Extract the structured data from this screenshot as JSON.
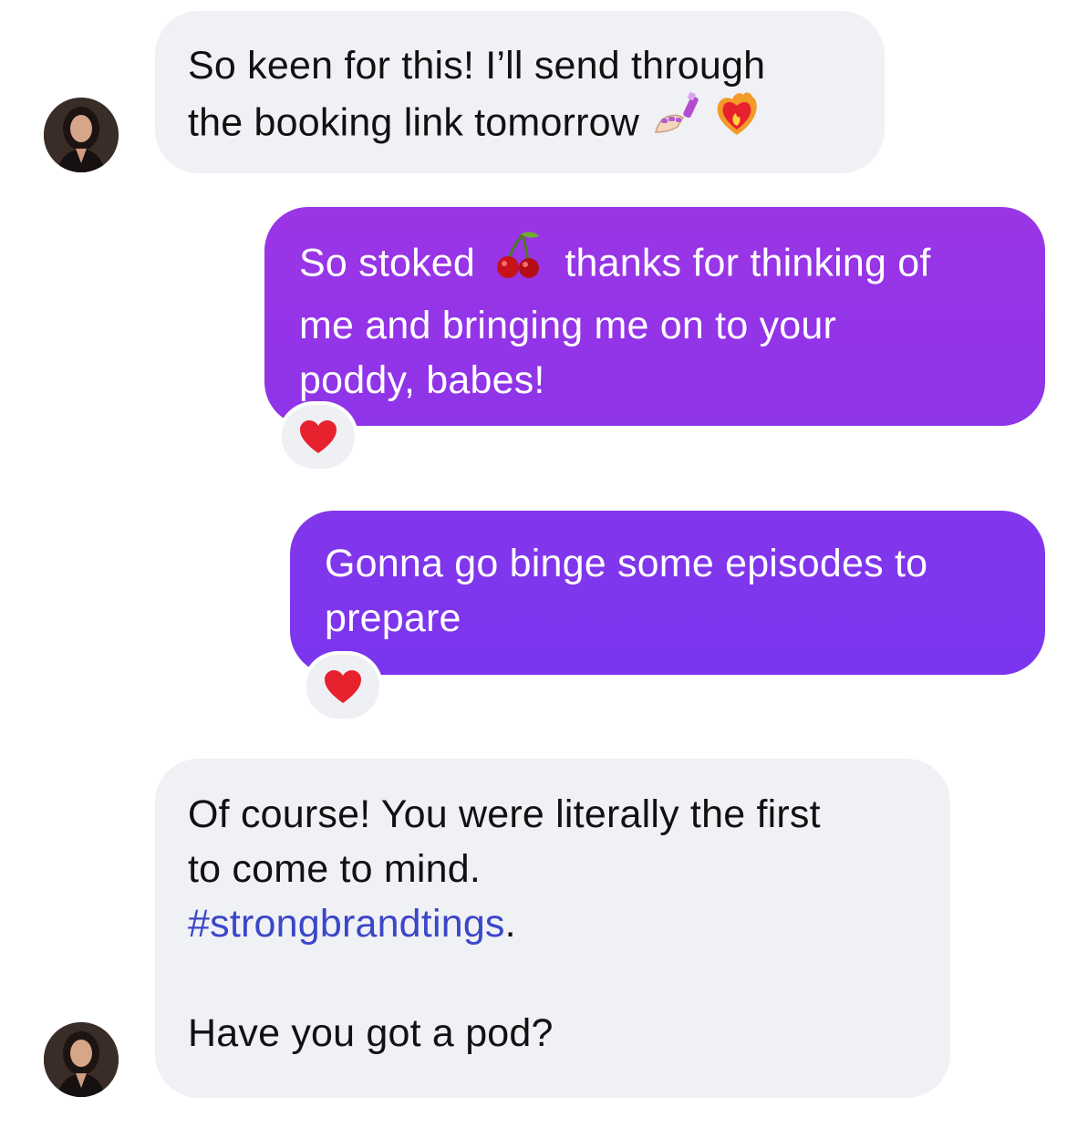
{
  "colors": {
    "incoming_bubble": "#eff1f5",
    "outgoing_gradient_top": "#9b35e6",
    "outgoing_gradient_bottom": "#7b35ee",
    "hashtag": "#3b46c9",
    "reaction_heart": "#e8212e"
  },
  "messages": [
    {
      "sender": "other",
      "lines": [
        "So keen for this! I’ll send through",
        "the booking link tomorrow"
      ],
      "emojis": [
        "nail-polish-icon",
        "heart-on-fire-icon"
      ]
    },
    {
      "sender": "me",
      "line1_before": "So stoked",
      "line1_after": "thanks for thinking of",
      "lines_rest": [
        "me and bringing me on to your",
        "poddy, babes!"
      ],
      "emojis": [
        "cherries-icon"
      ],
      "reaction": "red-heart-icon"
    },
    {
      "sender": "me",
      "lines": [
        "Gonna go binge some episodes to",
        "prepare"
      ],
      "reaction": "red-heart-icon"
    },
    {
      "sender": "other",
      "lines": [
        "Of course! You were literally the first",
        "to come to mind."
      ],
      "hashtag": "#strongbrandtings",
      "hashtag_suffix": ".",
      "last_line": "Have you got a pod?"
    }
  ]
}
